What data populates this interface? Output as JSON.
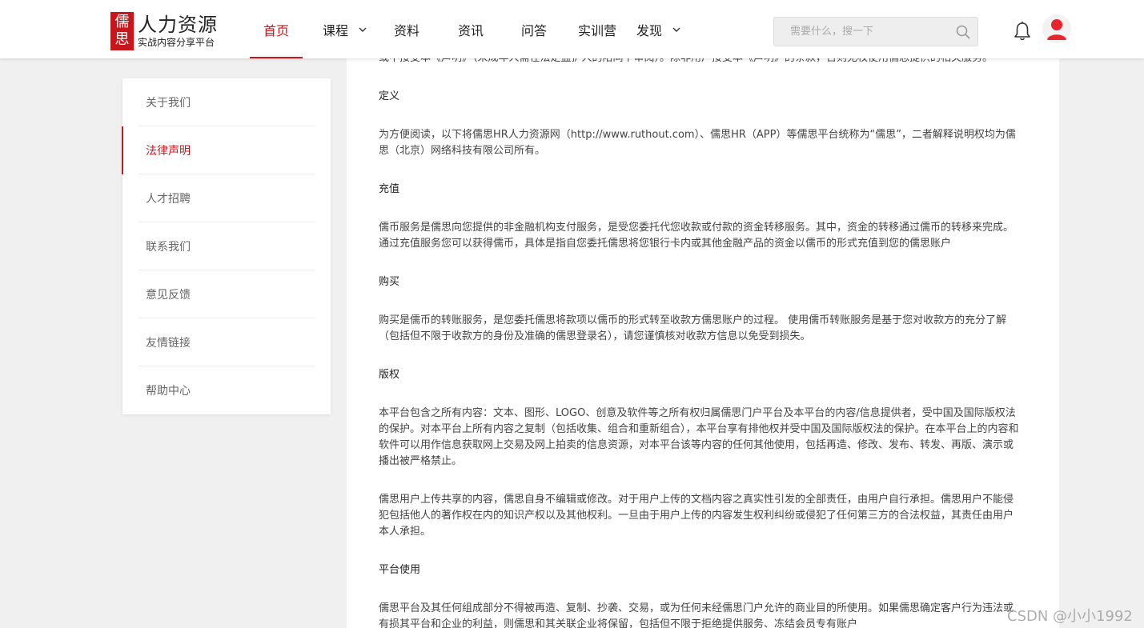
{
  "header": {
    "logo_mark_top": "儒",
    "logo_mark_bottom": "思",
    "logo_title": "人力资源",
    "logo_subtitle": "实战内容分享平台",
    "nav": [
      {
        "label": "首页",
        "active": true
      },
      {
        "label": "课程",
        "dropdown": true
      },
      {
        "label": "资料"
      },
      {
        "label": "资讯"
      },
      {
        "label": "问答"
      },
      {
        "label": "实训营"
      },
      {
        "label": "发现",
        "dropdown": true
      }
    ],
    "search": {
      "placeholder": "需要什么，搜一下"
    }
  },
  "sidebar": {
    "items": [
      {
        "label": "关于我们"
      },
      {
        "label": "法律声明",
        "active": true
      },
      {
        "label": "人才招聘"
      },
      {
        "label": "联系我们"
      },
      {
        "label": "意见反馈"
      },
      {
        "label": "友情链接"
      },
      {
        "label": "帮助中心"
      }
    ]
  },
  "content": {
    "intro": "或不接受本《声明》（未成年人需在法定监护人的陪同下审阅）。除非用户接受本《声明》的条款，否则无权使用儒思提供的相关服务。",
    "h_definition": "定义",
    "p_definition": "为方便阅读，以下将儒思HR人力资源网（http://www.ruthout.com）、儒思HR（APP）等儒思平台统称为“儒思”，二者解释说明权均为儒思（北京）网络科技有限公司所有。",
    "h_recharge": "充值",
    "p_recharge": "儒币服务是儒思向您提供的非金融机构支付服务，是受您委托代您收款或付款的资金转移服务。其中，资金的转移通过儒币的转移来完成。通过充值服务您可以获得儒币，具体是指自您委托儒思将您银行卡内或其他金融产品的资金以儒币的形式充值到您的儒思账户",
    "h_purchase": "购买",
    "p_purchase": "购买是儒币的转账服务，是您委托儒思将款项以儒币的形式转至收款方儒思账户的过程。 使用儒币转账服务是基于您对收款方的充分了解（包括但不限于收款方的身份及准确的儒思登录名），请您谨慎核对收款方信息以免受到损失。",
    "h_copyright": "版权",
    "p_copyright_1": "本平台包含之所有内容：文本、图形、LOGO、创意及软件等之所有权归属儒思门户平台及本平台的内容/信息提供者，受中国及国际版权法的保护。对本平台上所有内容之复制（包括收集、组合和重新组合），本平台享有排他权并受中国及国际版权法的保护。在本平台上的内容和软件可以用作信息获取网上交易及网上拍卖的信息资源，对本平台该等内容的任何其他使用，包括再造、修改、发布、转发、再版、演示或 播出被严格禁止。",
    "p_copyright_2": "儒思用户上传共享的内容，儒思自身不编辑或修改。对于用户上传的文档内容之真实性引发的全部责任，由用户自行承担。儒思用户不能侵犯包括他人的著作权在内的知识产权以及其他权利。一旦由于用户上传的内容发生权利纠纷或侵犯了任何第三方的合法权益，其责任由用户本人承担。",
    "h_usage": "平台使用",
    "p_usage": "儒思平台及其任何组成部分不得被再造、复制、抄袭、交易，或为任何未经儒思门户允许的商业目的所使用。如果儒思确定客户行为违法或有损其平台和企业的利益，则儒思和其关联企业将保留，包括但不限于拒绝提供服务、冻结会员专有账户"
  },
  "watermark": "CSDN @小小1992",
  "colors": {
    "accent": "#c8161d"
  }
}
